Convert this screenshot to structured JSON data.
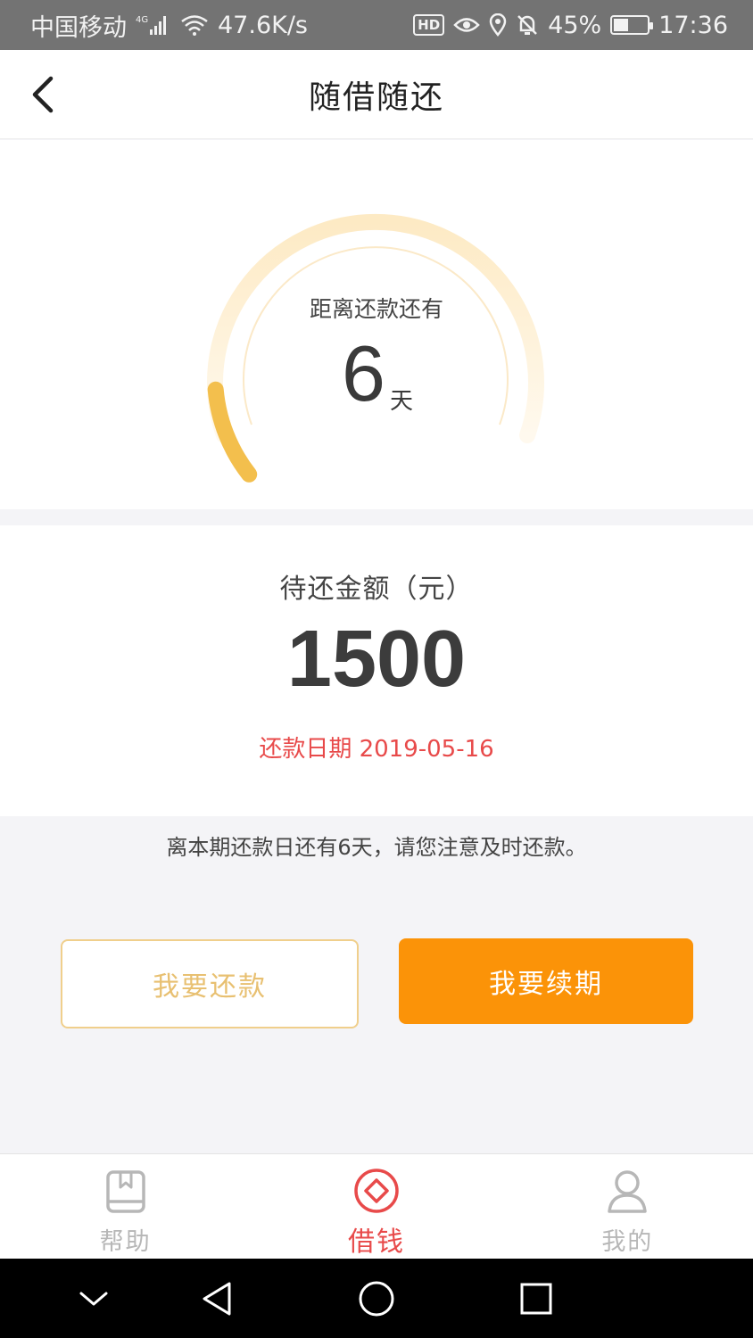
{
  "status_bar": {
    "carrier": "中国移动",
    "network": "4G",
    "speed": "47.6K/s",
    "hd": "HD",
    "battery": "45%",
    "battery_level": 0.45,
    "time": "17:36"
  },
  "header": {
    "title": "随借随还"
  },
  "countdown": {
    "label": "距离还款还有",
    "days": "6",
    "unit": "天",
    "colors": {
      "track": "#fdf0d6",
      "progress": "#f3bf4d"
    }
  },
  "amount": {
    "label": "待还金额（元）",
    "value": "1500",
    "due_date": "还款日期 2019-05-16"
  },
  "notice": "离本期还款日还有6天，请您注意及时还款。",
  "buttons": {
    "repay": "我要还款",
    "renew": "我要续期"
  },
  "bottom_nav": {
    "items": [
      {
        "label": "帮助",
        "icon": "book-icon",
        "active": false
      },
      {
        "label": "借钱",
        "icon": "diamond-circle-icon",
        "active": true
      },
      {
        "label": "我的",
        "icon": "person-icon",
        "active": false
      }
    ]
  },
  "colors": {
    "accent_orange": "#fb9308",
    "accent_red": "#e84a4a",
    "gold_outline": "#f0cf8c"
  }
}
